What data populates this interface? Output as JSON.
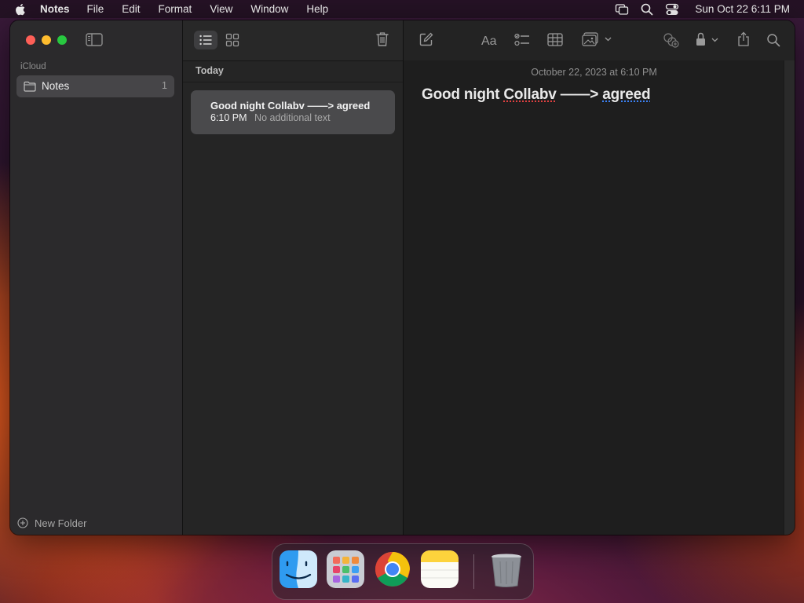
{
  "menubar": {
    "app_name": "Notes",
    "menus": [
      "File",
      "Edit",
      "Format",
      "View",
      "Window",
      "Help"
    ],
    "clock": "Sun Oct 22  6:11 PM",
    "icons": [
      "apple-icon",
      "screen-mirroring-icon",
      "spotlight-search-icon",
      "control-center-icon"
    ]
  },
  "sidebar": {
    "section": "iCloud",
    "folders": [
      {
        "label": "Notes",
        "count": "1"
      }
    ],
    "new_folder": "New Folder"
  },
  "list": {
    "section": "Today",
    "notes": [
      {
        "title": "Good night Collabv ——> agreed",
        "time": "6:10 PM",
        "preview": "No additional text"
      }
    ]
  },
  "editor": {
    "date": "October 22, 2023 at 6:10 PM",
    "title_parts": {
      "a": "Good night ",
      "b": "Collabv",
      "c": " ——> ",
      "d": "agreed"
    }
  },
  "colors": {
    "close": "#fe5f57",
    "minimize": "#febc2e",
    "maximize": "#28c840",
    "selection": "#464548",
    "notes_yellow": "#fdd33c"
  },
  "dock": {
    "apps": [
      "finder-icon",
      "launchpad-icon",
      "chrome-icon",
      "notes-icon",
      "trash-icon"
    ]
  }
}
